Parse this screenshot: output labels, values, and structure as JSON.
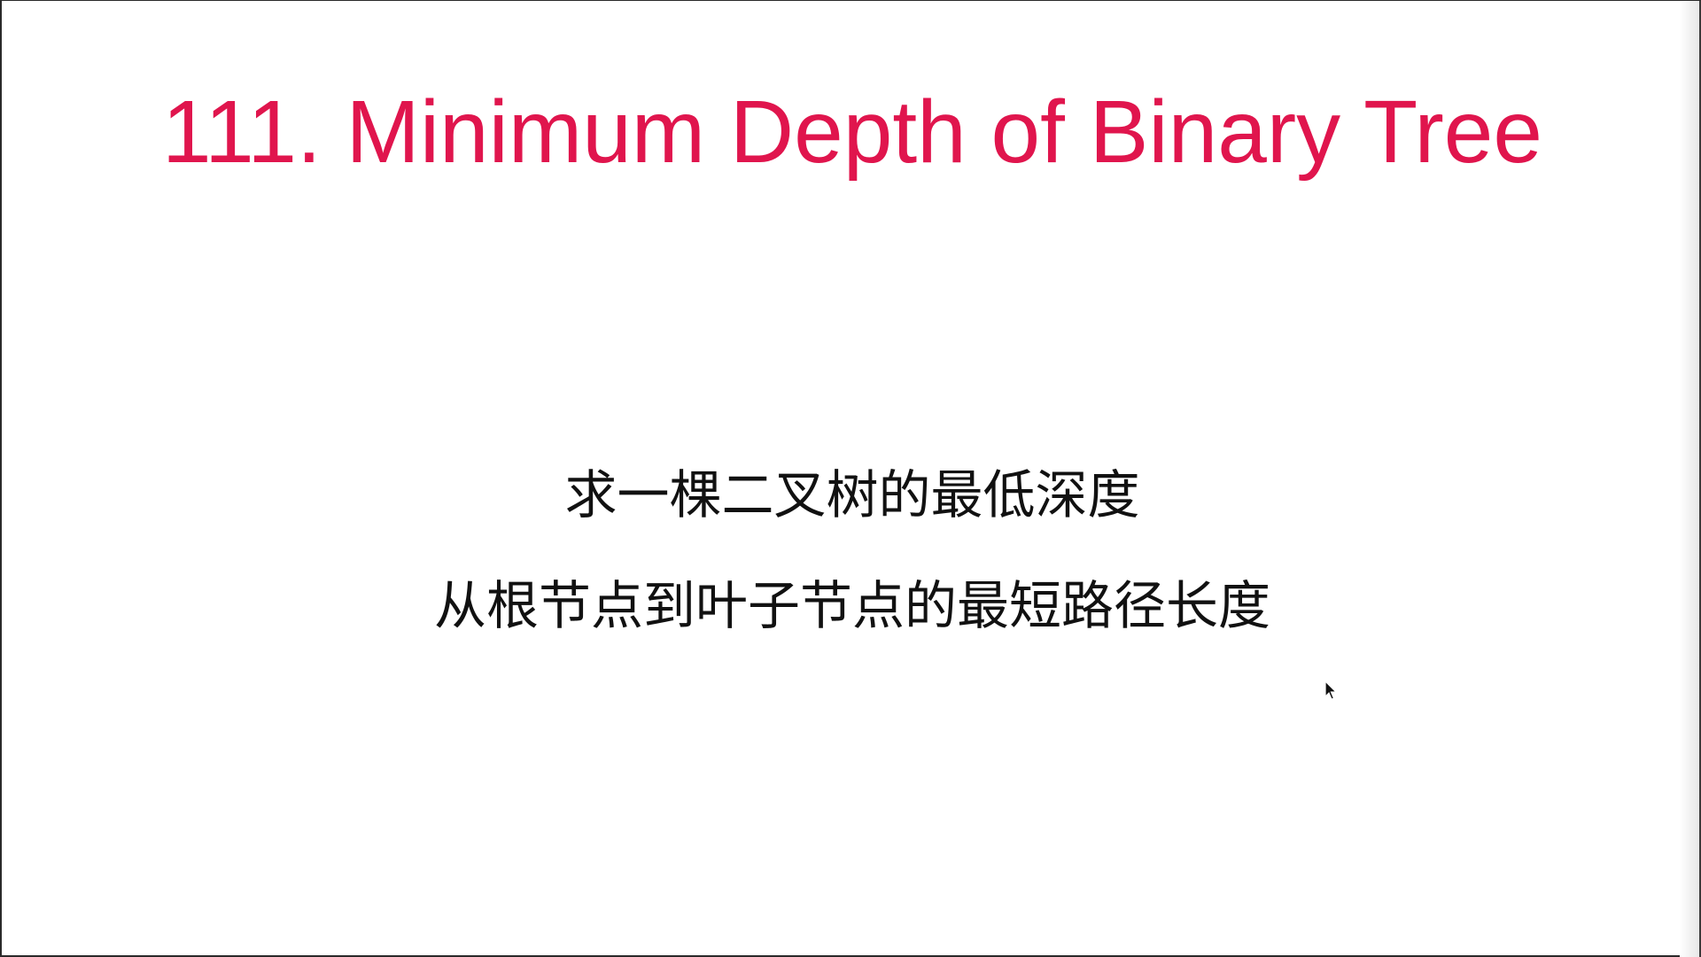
{
  "slide": {
    "title": "111. Minimum Depth of Binary Tree",
    "lines": [
      "求一棵二叉树的最低深度",
      "从根节点到叶子节点的最短路径长度"
    ]
  },
  "colors": {
    "title": "#e0154d",
    "text": "#111111",
    "background": "#ffffff"
  },
  "icons": {
    "cursor": "mouse-pointer-icon"
  }
}
